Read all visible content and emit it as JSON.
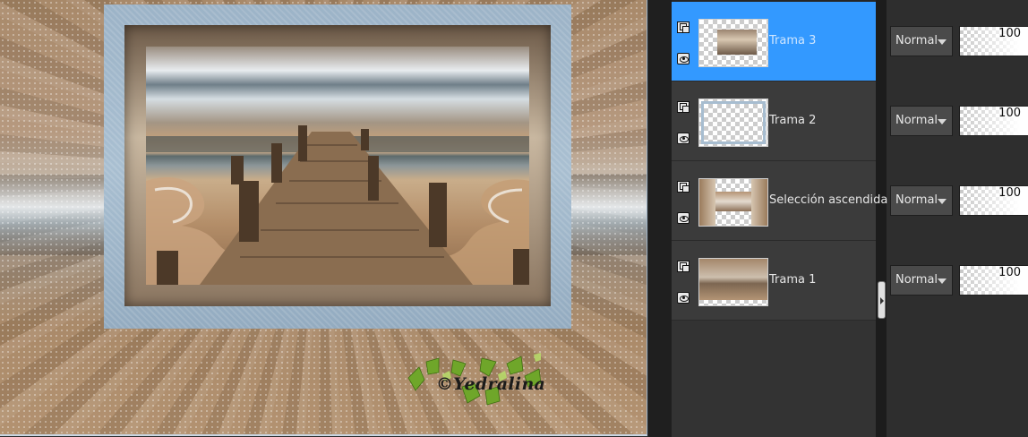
{
  "canvas": {
    "watermark": "©Yedralina"
  },
  "layers": [
    {
      "name": "Trama 3",
      "selected": true,
      "blend_mode": "Normal",
      "opacity": "100"
    },
    {
      "name": "Trama 2",
      "selected": false,
      "blend_mode": "Normal",
      "opacity": "100"
    },
    {
      "name": "Selección ascendida",
      "selected": false,
      "blend_mode": "Normal",
      "opacity": "100"
    },
    {
      "name": "Trama 1",
      "selected": false,
      "blend_mode": "Normal",
      "opacity": "100"
    }
  ],
  "colors": {
    "selected_layer": "#3399ff",
    "frame_blue": "#9cb3c7"
  },
  "icons": [
    "layer-group-icon",
    "visibility-eye-icon",
    "dropdown-arrow-icon",
    "panel-collapse-icon"
  ]
}
